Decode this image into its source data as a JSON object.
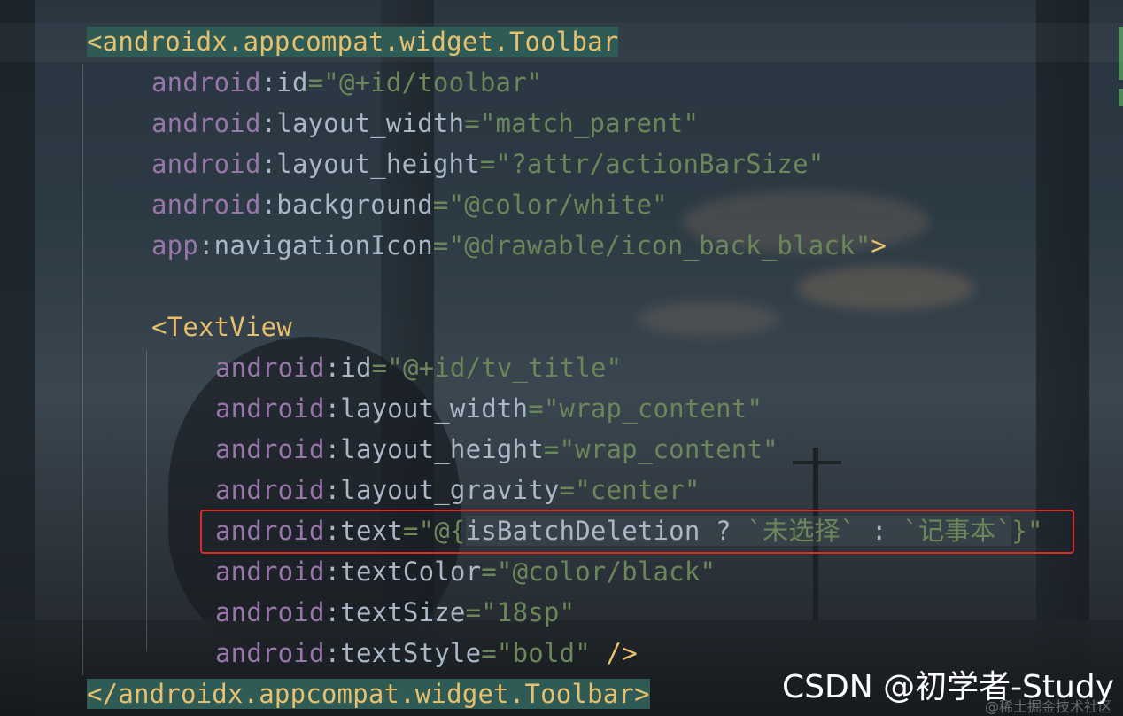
{
  "colors": {
    "tag": "#e8bf6a",
    "attribute_namespace": "#9876aa",
    "plain": "#a9b7c6",
    "string": "#6a8759",
    "highlight": "#2f5b57",
    "annotation_box": "#d22f2a"
  },
  "code": {
    "toolbar_open_bracket": "<",
    "toolbar_open_name": "androidx.appcompat.widget.Toolbar",
    "toolbar_attrs": [
      {
        "ns": "android",
        "name": "id",
        "value": "\"@+id/toolbar\"",
        "tail": ""
      },
      {
        "ns": "android",
        "name": "layout_width",
        "value": "\"match_parent\"",
        "tail": ""
      },
      {
        "ns": "android",
        "name": "layout_height",
        "value": "\"?attr/actionBarSize\"",
        "tail": ""
      },
      {
        "ns": "android",
        "name": "background",
        "value": "\"@color/white\"",
        "tail": ""
      },
      {
        "ns": "app",
        "name": "navigationIcon",
        "value": "\"@drawable/icon_back_black\"",
        "tail": ">"
      }
    ],
    "textview_open": "<TextView",
    "textview_attrs": [
      {
        "ns": "android",
        "name": "id",
        "value": "\"@+id/tv_title\"",
        "tail": ""
      },
      {
        "ns": "android",
        "name": "layout_width",
        "value": "\"wrap_content\"",
        "tail": ""
      },
      {
        "ns": "android",
        "name": "layout_height",
        "value": "\"wrap_content\"",
        "tail": ""
      },
      {
        "ns": "android",
        "name": "layout_gravity",
        "value": "\"center\"",
        "tail": ""
      }
    ],
    "text_line": {
      "ns": "android",
      "name": "text",
      "value_start": "\"@{",
      "expr_var": "isBatchDeletion ? ",
      "expr_a": "`未选择`",
      "expr_sep": " : ",
      "expr_b": "`记事本`",
      "value_end": "}\""
    },
    "textview_attrs_after": [
      {
        "ns": "android",
        "name": "textColor",
        "value": "\"@color/black\"",
        "tail": ""
      },
      {
        "ns": "android",
        "name": "textSize",
        "value": "\"18sp\"",
        "tail": ""
      },
      {
        "ns": "android",
        "name": "textStyle",
        "value": "\"bold\"",
        "tail": " />"
      }
    ],
    "toolbar_close": "</androidx.appcompat.widget.Toolbar>"
  },
  "watermark": {
    "main": "CSDN @初学者-Study",
    "sub": "@稀土掘金技术社区"
  }
}
